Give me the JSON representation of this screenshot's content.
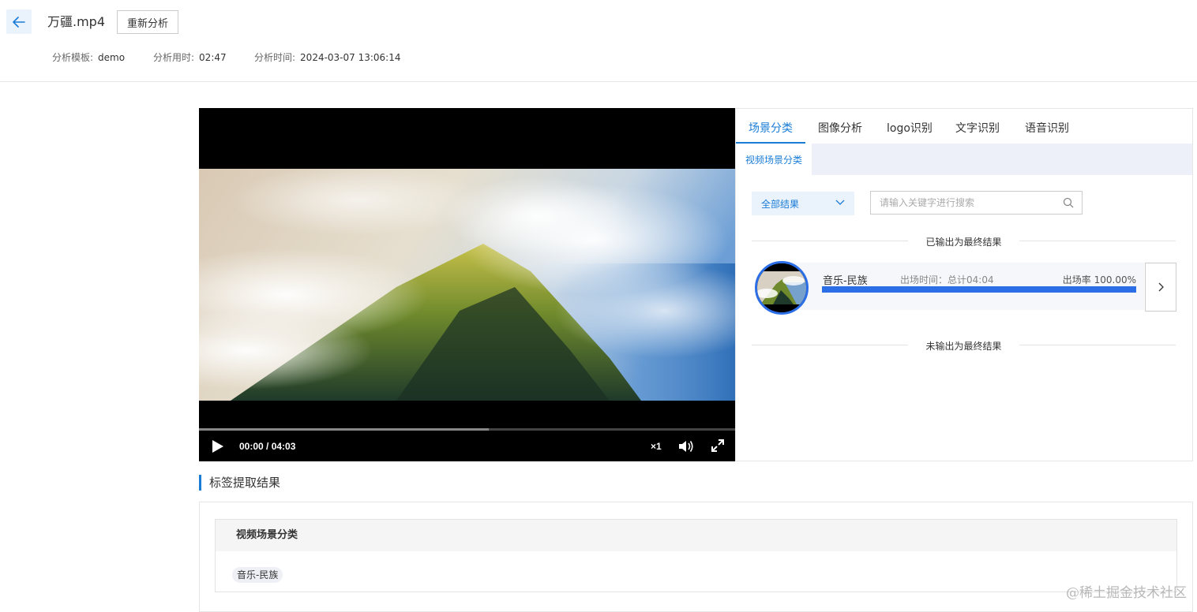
{
  "header": {
    "file_name": "万疆.mp4",
    "reanalyze_label": "重新分析",
    "meta": [
      {
        "key": "分析模板:",
        "value": "demo"
      },
      {
        "key": "分析用时:",
        "value": "02:47"
      },
      {
        "key": "分析时间:",
        "value": "2024-03-07 13:06:14"
      }
    ]
  },
  "player": {
    "time": "00:00 / 04:03",
    "progress_buffered": 0.54,
    "speed": "×1"
  },
  "panel": {
    "tabs": [
      {
        "label": "场景分类",
        "active": true
      },
      {
        "label": "图像分析",
        "active": false
      },
      {
        "label": "logo识别",
        "active": false
      },
      {
        "label": "文字识别",
        "active": false
      },
      {
        "label": "语音识别",
        "active": false
      }
    ],
    "subtab": "视频场景分类",
    "filter_label": "全部结果",
    "search_placeholder": "请输入关键字进行搜索",
    "output_final": "已输出为最终结果",
    "output_not_final": "未输出为最终结果",
    "result": {
      "label": "音乐-民族",
      "time": "出场时间：总计04:04",
      "rate": "出场率 100.00%",
      "rate_value": 1.0
    }
  },
  "tags": {
    "section_title": "标签提取结果",
    "table_header": "视频场景分类",
    "chip": "音乐-民族"
  },
  "watermark": "@稀土掘金技术社区",
  "colors": {
    "accent": "#1a7cd6",
    "bar": "#2b6ee6"
  }
}
